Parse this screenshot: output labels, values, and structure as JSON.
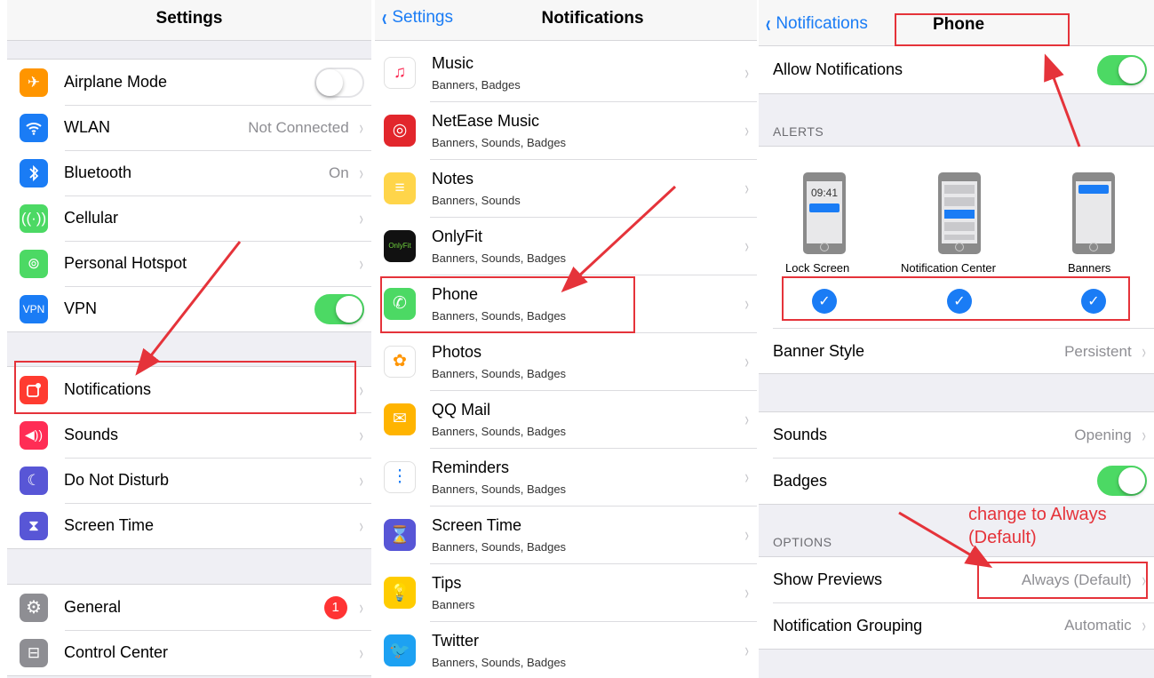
{
  "panel1": {
    "title": "Settings",
    "group1": [
      {
        "label": "Airplane Mode",
        "icon": "airplane-icon",
        "color": "#ff9500",
        "toggle": "off"
      },
      {
        "label": "WLAN",
        "icon": "wifi-icon",
        "color": "#1a7cf5",
        "value": "Not Connected"
      },
      {
        "label": "Bluetooth",
        "icon": "bluetooth-icon",
        "color": "#1a7cf5",
        "value": "On"
      },
      {
        "label": "Cellular",
        "icon": "cellular-icon",
        "color": "#4cd964"
      },
      {
        "label": "Personal Hotspot",
        "icon": "hotspot-icon",
        "color": "#4cd964"
      },
      {
        "label": "VPN",
        "icon": "vpn-icon",
        "color": "#1a7cf5",
        "toggle": "on",
        "icon_text": "VPN"
      }
    ],
    "group2": [
      {
        "label": "Notifications",
        "icon": "notifications-icon",
        "color": "#ff3b30"
      },
      {
        "label": "Sounds",
        "icon": "sounds-icon",
        "color": "#ff2d55"
      },
      {
        "label": "Do Not Disturb",
        "icon": "moon-icon",
        "color": "#5856d6"
      },
      {
        "label": "Screen Time",
        "icon": "hourglass-icon",
        "color": "#5856d6"
      }
    ],
    "group3": [
      {
        "label": "General",
        "icon": "gear-icon",
        "color": "#8e8e93",
        "badge": "1"
      },
      {
        "label": "Control Center",
        "icon": "control-center-icon",
        "color": "#8e8e93"
      }
    ]
  },
  "panel2": {
    "back": "Settings",
    "title": "Notifications",
    "apps": [
      {
        "name": "Music",
        "sub": "Banners, Badges",
        "icon": "music-icon",
        "color": "#ffffff",
        "glyph": "♫",
        "glyph_color": "#fa2d55"
      },
      {
        "name": "NetEase Music",
        "sub": "Banners, Sounds, Badges",
        "icon": "netease-music-icon",
        "color": "#e2262c",
        "glyph": "◎",
        "glyph_color": "#ffffff"
      },
      {
        "name": "Notes",
        "sub": "Banners, Sounds",
        "icon": "notes-icon",
        "color": "#ffd54a",
        "glyph": "≡",
        "glyph_color": "#ffffff"
      },
      {
        "name": "OnlyFit",
        "sub": "Banners, Sounds, Badges",
        "icon": "onlyfit-icon",
        "color": "#111111",
        "glyph": "OnlyFit",
        "glyph_color": "#6fd33d"
      },
      {
        "name": "Phone",
        "sub": "Banners, Sounds, Badges",
        "icon": "phone-icon",
        "color": "#4cd964",
        "glyph": "✆",
        "glyph_color": "#ffffff"
      },
      {
        "name": "Photos",
        "sub": "Banners, Sounds, Badges",
        "icon": "photos-icon",
        "color": "#ffffff",
        "glyph": "✿",
        "glyph_color": "#ff9500"
      },
      {
        "name": "QQ Mail",
        "sub": "Banners, Sounds, Badges",
        "icon": "qq-mail-icon",
        "color": "#ffb400",
        "glyph": "✉",
        "glyph_color": "#ffffff"
      },
      {
        "name": "Reminders",
        "sub": "Banners, Sounds, Badges",
        "icon": "reminders-icon",
        "color": "#ffffff",
        "glyph": "⋮",
        "glyph_color": "#1a7cf5"
      },
      {
        "name": "Screen Time",
        "sub": "Banners, Sounds, Badges",
        "icon": "hourglass-icon",
        "color": "#5856d6",
        "glyph": "⌛",
        "glyph_color": "#ffffff"
      },
      {
        "name": "Tips",
        "sub": "Banners",
        "icon": "tips-icon",
        "color": "#ffcc00",
        "glyph": "💡",
        "glyph_color": "#ffffff"
      },
      {
        "name": "Twitter",
        "sub": "Banners, Sounds, Badges",
        "icon": "twitter-icon",
        "color": "#1da1f2",
        "glyph": "🐦",
        "glyph_color": "#ffffff"
      }
    ]
  },
  "panel3": {
    "back": "Notifications",
    "title": "Phone",
    "allow_notifications": "Allow Notifications",
    "alerts_header": "ALERTS",
    "lock_time": "09:41",
    "alert_styles": [
      "Lock Screen",
      "Notification Center",
      "Banners"
    ],
    "banner_style": {
      "label": "Banner Style",
      "value": "Persistent"
    },
    "sounds": {
      "label": "Sounds",
      "value": "Opening"
    },
    "badges": {
      "label": "Badges"
    },
    "options_header": "OPTIONS",
    "show_previews": {
      "label": "Show Previews",
      "value": "Always (Default)"
    },
    "grouping": {
      "label": "Notification Grouping",
      "value": "Automatic"
    },
    "annotation": "change to Always\n(Default)"
  },
  "accent": "#e5333a"
}
